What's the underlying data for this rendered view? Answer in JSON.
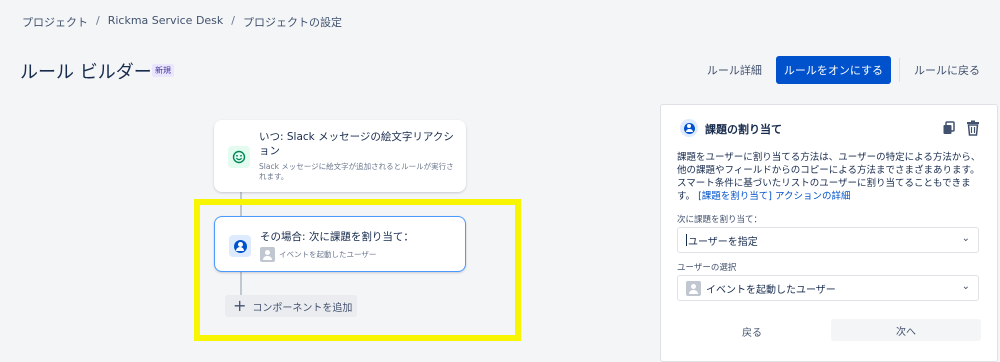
{
  "breadcrumb": {
    "items": [
      "プロジェクト",
      "Rickma Service Desk",
      "プロジェクトの設定"
    ],
    "separator": "/"
  },
  "header": {
    "title": "ルール ビルダー",
    "badge": "新規",
    "actions": {
      "rule_details": "ルール詳細",
      "turn_on": "ルールをオンにする",
      "back_to_rules": "ルールに戻る"
    }
  },
  "flow": {
    "trigger": {
      "icon": "emoji-reaction-icon",
      "title": "いつ: Slack メッセージの絵文字リアクション",
      "description": "Slack メッセージに絵文字が追加されるとルールが実行されます。"
    },
    "action": {
      "icon": "user-assign-icon",
      "title": "その場合: 次に課題を割り当て：",
      "subtitle": "イベントを起動したユーザー"
    },
    "add_component_label": "コンポーネントを追加"
  },
  "panel": {
    "title": "課題の割り当て",
    "description": "課題をユーザーに割り当てる方法は、ユーザーの特定による方法から、他の課題やフィールドからのコピーによる方法までさまざまあります。スマート条件に基づいたリストのユーザーに割り当てることもできます。",
    "link_text": "[課題を割り当て] アクションの詳細",
    "assign_label": "次に課題を割り当て：",
    "assign_value": "ユーザーを指定",
    "user_label": "ユーザーの選択",
    "user_value": "イベントを起動したユーザー",
    "back_label": "戻る",
    "next_label": "次へ"
  },
  "colors": {
    "primary": "#0052cc",
    "highlight": "#f7f500",
    "selected_border": "#4c9aff"
  }
}
